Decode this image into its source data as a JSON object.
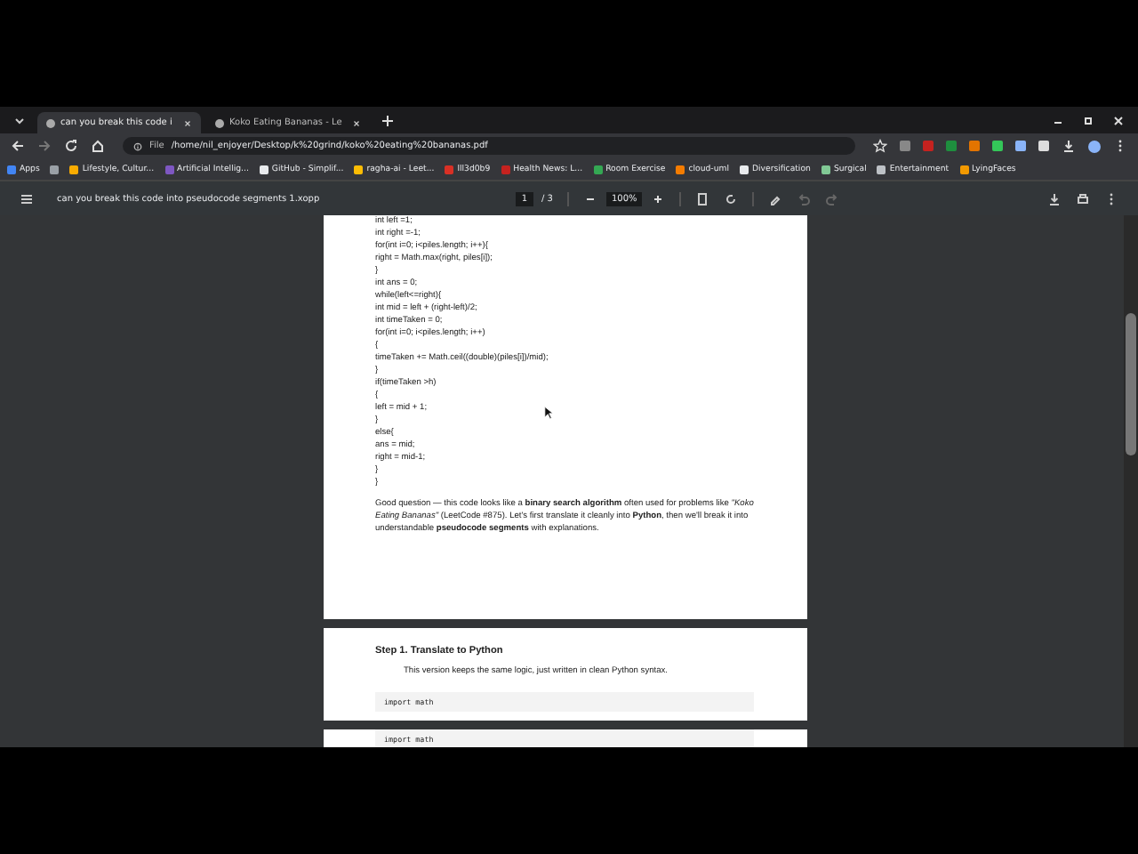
{
  "tabs": [
    {
      "title": "can you break this code i",
      "selected": true
    },
    {
      "title": "Koko Eating Bananas - Le",
      "selected": false
    }
  ],
  "address": {
    "scheme": "File",
    "url": "/home/nil_enjoyer/Desktop/k%20grind/koko%20eating%20bananas.pdf"
  },
  "bookmarks": [
    {
      "label": "Apps",
      "color": "#4285f4"
    },
    {
      "color": "#9aa0a6"
    },
    {
      "label": "Lifestyle, Cultur...",
      "color": "#f9ab00"
    },
    {
      "label": "Artificial Intellig...",
      "color": "#7e57c2"
    },
    {
      "label": "GitHub - Simplif...",
      "color": "#e8eaed"
    },
    {
      "label": "ragha-ai - Leet...",
      "color": "#fbbc04"
    },
    {
      "label": "lll3d0b9",
      "color": "#d93025"
    },
    {
      "label": "Health News: L...",
      "color": "#c5221f"
    },
    {
      "label": "Room Exercise",
      "color": "#34a853"
    },
    {
      "label": "cloud-uml",
      "color": "#f57c00"
    },
    {
      "label": "Diversification",
      "color": "#e8eaed"
    },
    {
      "label": "Surgical",
      "color": "#81c995"
    },
    {
      "label": "Entertainment",
      "color": "#bdc1c6"
    },
    {
      "label": "LyingFaces",
      "color": "#f29900"
    }
  ],
  "pdf_toolbar": {
    "title": "can you break this code into pseudocode segments 1.xopp",
    "page": "1",
    "page_total": "/ 3",
    "zoom": "100%"
  },
  "page1": {
    "code": [
      "int left =1;",
      "int right =-1;",
      "for(int i=0; i<piles.length; i++){",
      "right = Math.max(right, piles[i]);",
      "}",
      "int ans = 0;",
      "while(left<=right){",
      "int mid = left + (right-left)/2;",
      "int timeTaken = 0;",
      "for(int i=0; i<piles.length; i++)",
      "{",
      "timeTaken += Math.ceil((double)(piles[i])/mid);",
      "}",
      "if(timeTaken >h)",
      "{",
      "left = mid + 1;",
      "}",
      "else{",
      "ans = mid;",
      "right = mid-1;",
      "}",
      "}"
    ],
    "paragraph": "Good question — this code looks like a **binary search algorithm** often used for problems like *\"Koko Eating Bananas\"* (LeetCode #875). Let's first translate it cleanly into **Python**, then we'll break it into understandable **pseudocode segments** with explanations."
  },
  "page2": {
    "heading": "Step 1. Translate to Python",
    "note": "This version keeps the same logic, just written in clean Python syntax.",
    "code": "import math"
  },
  "page3": {
    "code": "import math"
  }
}
